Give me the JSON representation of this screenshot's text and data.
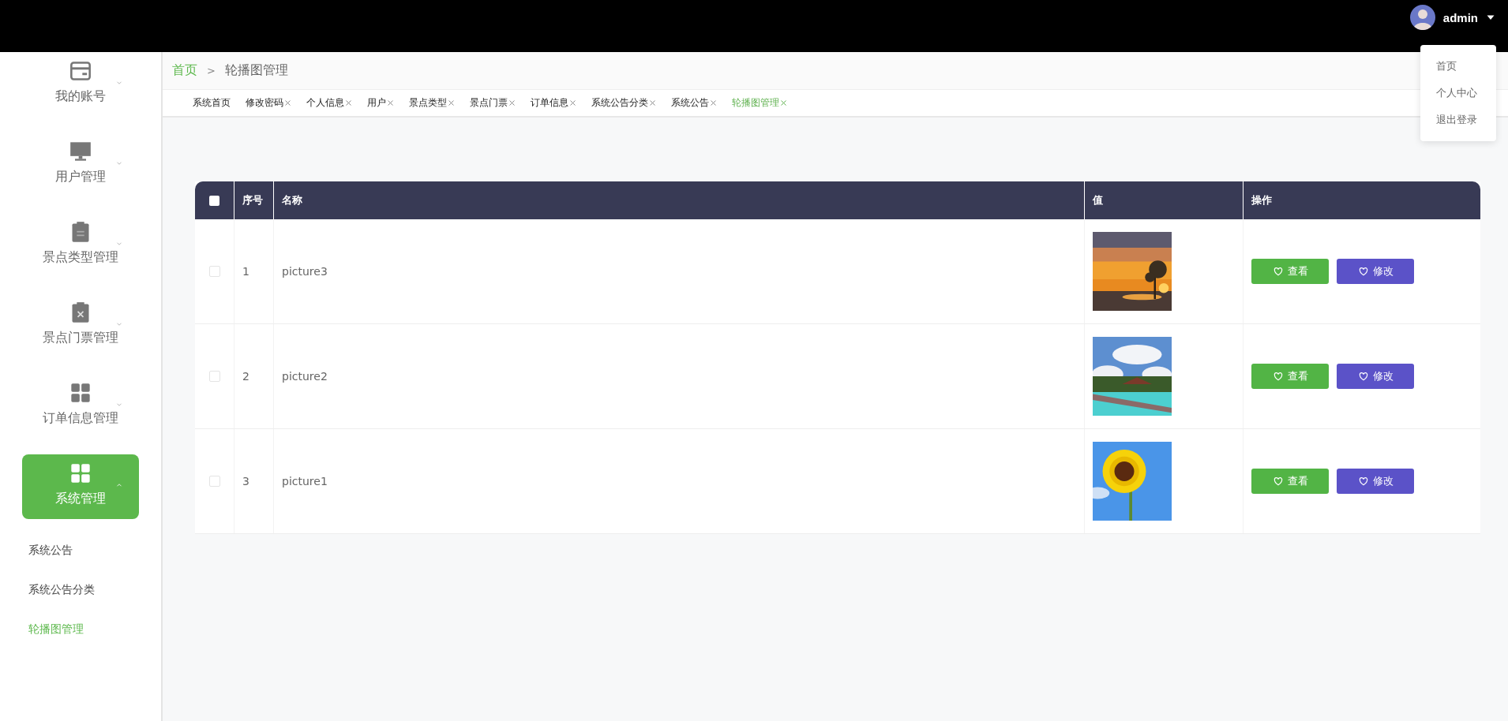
{
  "user_menu": {
    "username": "admin",
    "items": [
      {
        "label": "首页"
      },
      {
        "label": "个人中心"
      },
      {
        "label": "退出登录"
      }
    ]
  },
  "sidebar": {
    "items": [
      {
        "label": "我的账号",
        "expanded": false,
        "selected": false
      },
      {
        "label": "用户管理",
        "expanded": false,
        "selected": false
      },
      {
        "label": "景点类型管理",
        "expanded": false,
        "selected": false
      },
      {
        "label": "景点门票管理",
        "expanded": false,
        "selected": false
      },
      {
        "label": "订单信息管理",
        "expanded": false,
        "selected": false
      },
      {
        "label": "系统管理",
        "expanded": true,
        "selected": true,
        "children": [
          {
            "label": "系统公告",
            "selected": false
          },
          {
            "label": "系统公告分类",
            "selected": false
          },
          {
            "label": "轮播图管理",
            "selected": true
          }
        ]
      }
    ]
  },
  "breadcrumb": {
    "separator": ">",
    "items": [
      {
        "label": "首页"
      },
      {
        "label": "轮播图管理"
      }
    ]
  },
  "tabs": [
    {
      "label": "系统首页",
      "closable": false,
      "selected": false
    },
    {
      "label": "修改密码",
      "closable": true,
      "selected": false
    },
    {
      "label": "个人信息",
      "closable": true,
      "selected": false
    },
    {
      "label": "用户",
      "closable": true,
      "selected": false
    },
    {
      "label": "景点类型",
      "closable": true,
      "selected": false
    },
    {
      "label": "景点门票",
      "closable": true,
      "selected": false
    },
    {
      "label": "订单信息",
      "closable": true,
      "selected": false
    },
    {
      "label": "系统公告分类",
      "closable": true,
      "selected": false
    },
    {
      "label": "系统公告",
      "closable": true,
      "selected": false
    },
    {
      "label": "轮播图管理",
      "closable": true,
      "selected": true
    }
  ],
  "table": {
    "select_all_checked": false,
    "columns": [
      "序号",
      "名称",
      "值",
      "操作"
    ],
    "rows": [
      {
        "checked": false,
        "index": "1",
        "name": "picture3",
        "image": {
          "kind": "picture"
        },
        "actions": [
          "查看",
          "修改"
        ]
      },
      {
        "checked": false,
        "index": "2",
        "name": "picture2",
        "image": {
          "kind": "picture"
        },
        "actions": [
          "查看",
          "修改"
        ]
      },
      {
        "checked": false,
        "index": "3",
        "name": "picture1",
        "image": {
          "kind": "picture"
        },
        "actions": [
          "查看",
          "修改"
        ]
      }
    ]
  }
}
